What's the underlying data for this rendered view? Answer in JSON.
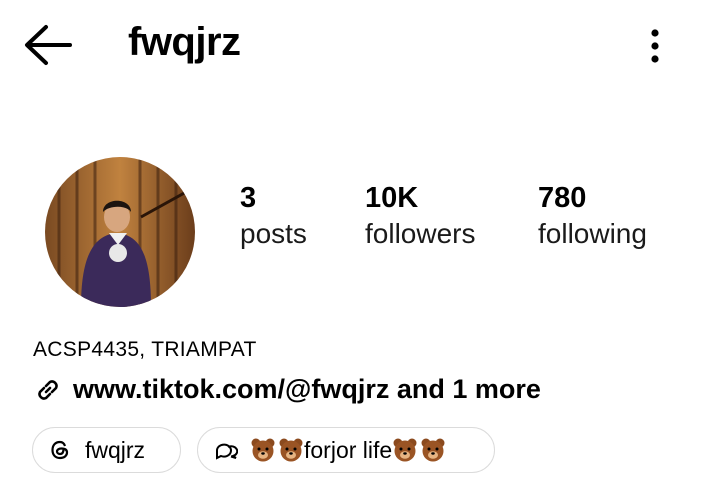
{
  "header": {
    "username": "fwqjrz",
    "back_icon": "arrow-left-icon",
    "more_icon": "vertical-ellipsis-icon"
  },
  "stats": [
    {
      "value": "3",
      "label": "posts"
    },
    {
      "value": "10K",
      "label": "followers"
    },
    {
      "value": "780",
      "label": "following"
    }
  ],
  "bio": {
    "name": "ACSP4435, TRIAMPAT",
    "link_text": "www.tiktok.com/@fwqjrz and 1 more",
    "link_icon": "link-chain-icon"
  },
  "chips": {
    "threads_label": "fwqjrz",
    "threads_icon": "threads-icon",
    "note_text": "forjor life",
    "note_icon": "chat-bubble-icon",
    "emoji": "bear-face-emoji"
  },
  "colors": {
    "text": "#000000",
    "chip_border": "#dbdbdb"
  }
}
